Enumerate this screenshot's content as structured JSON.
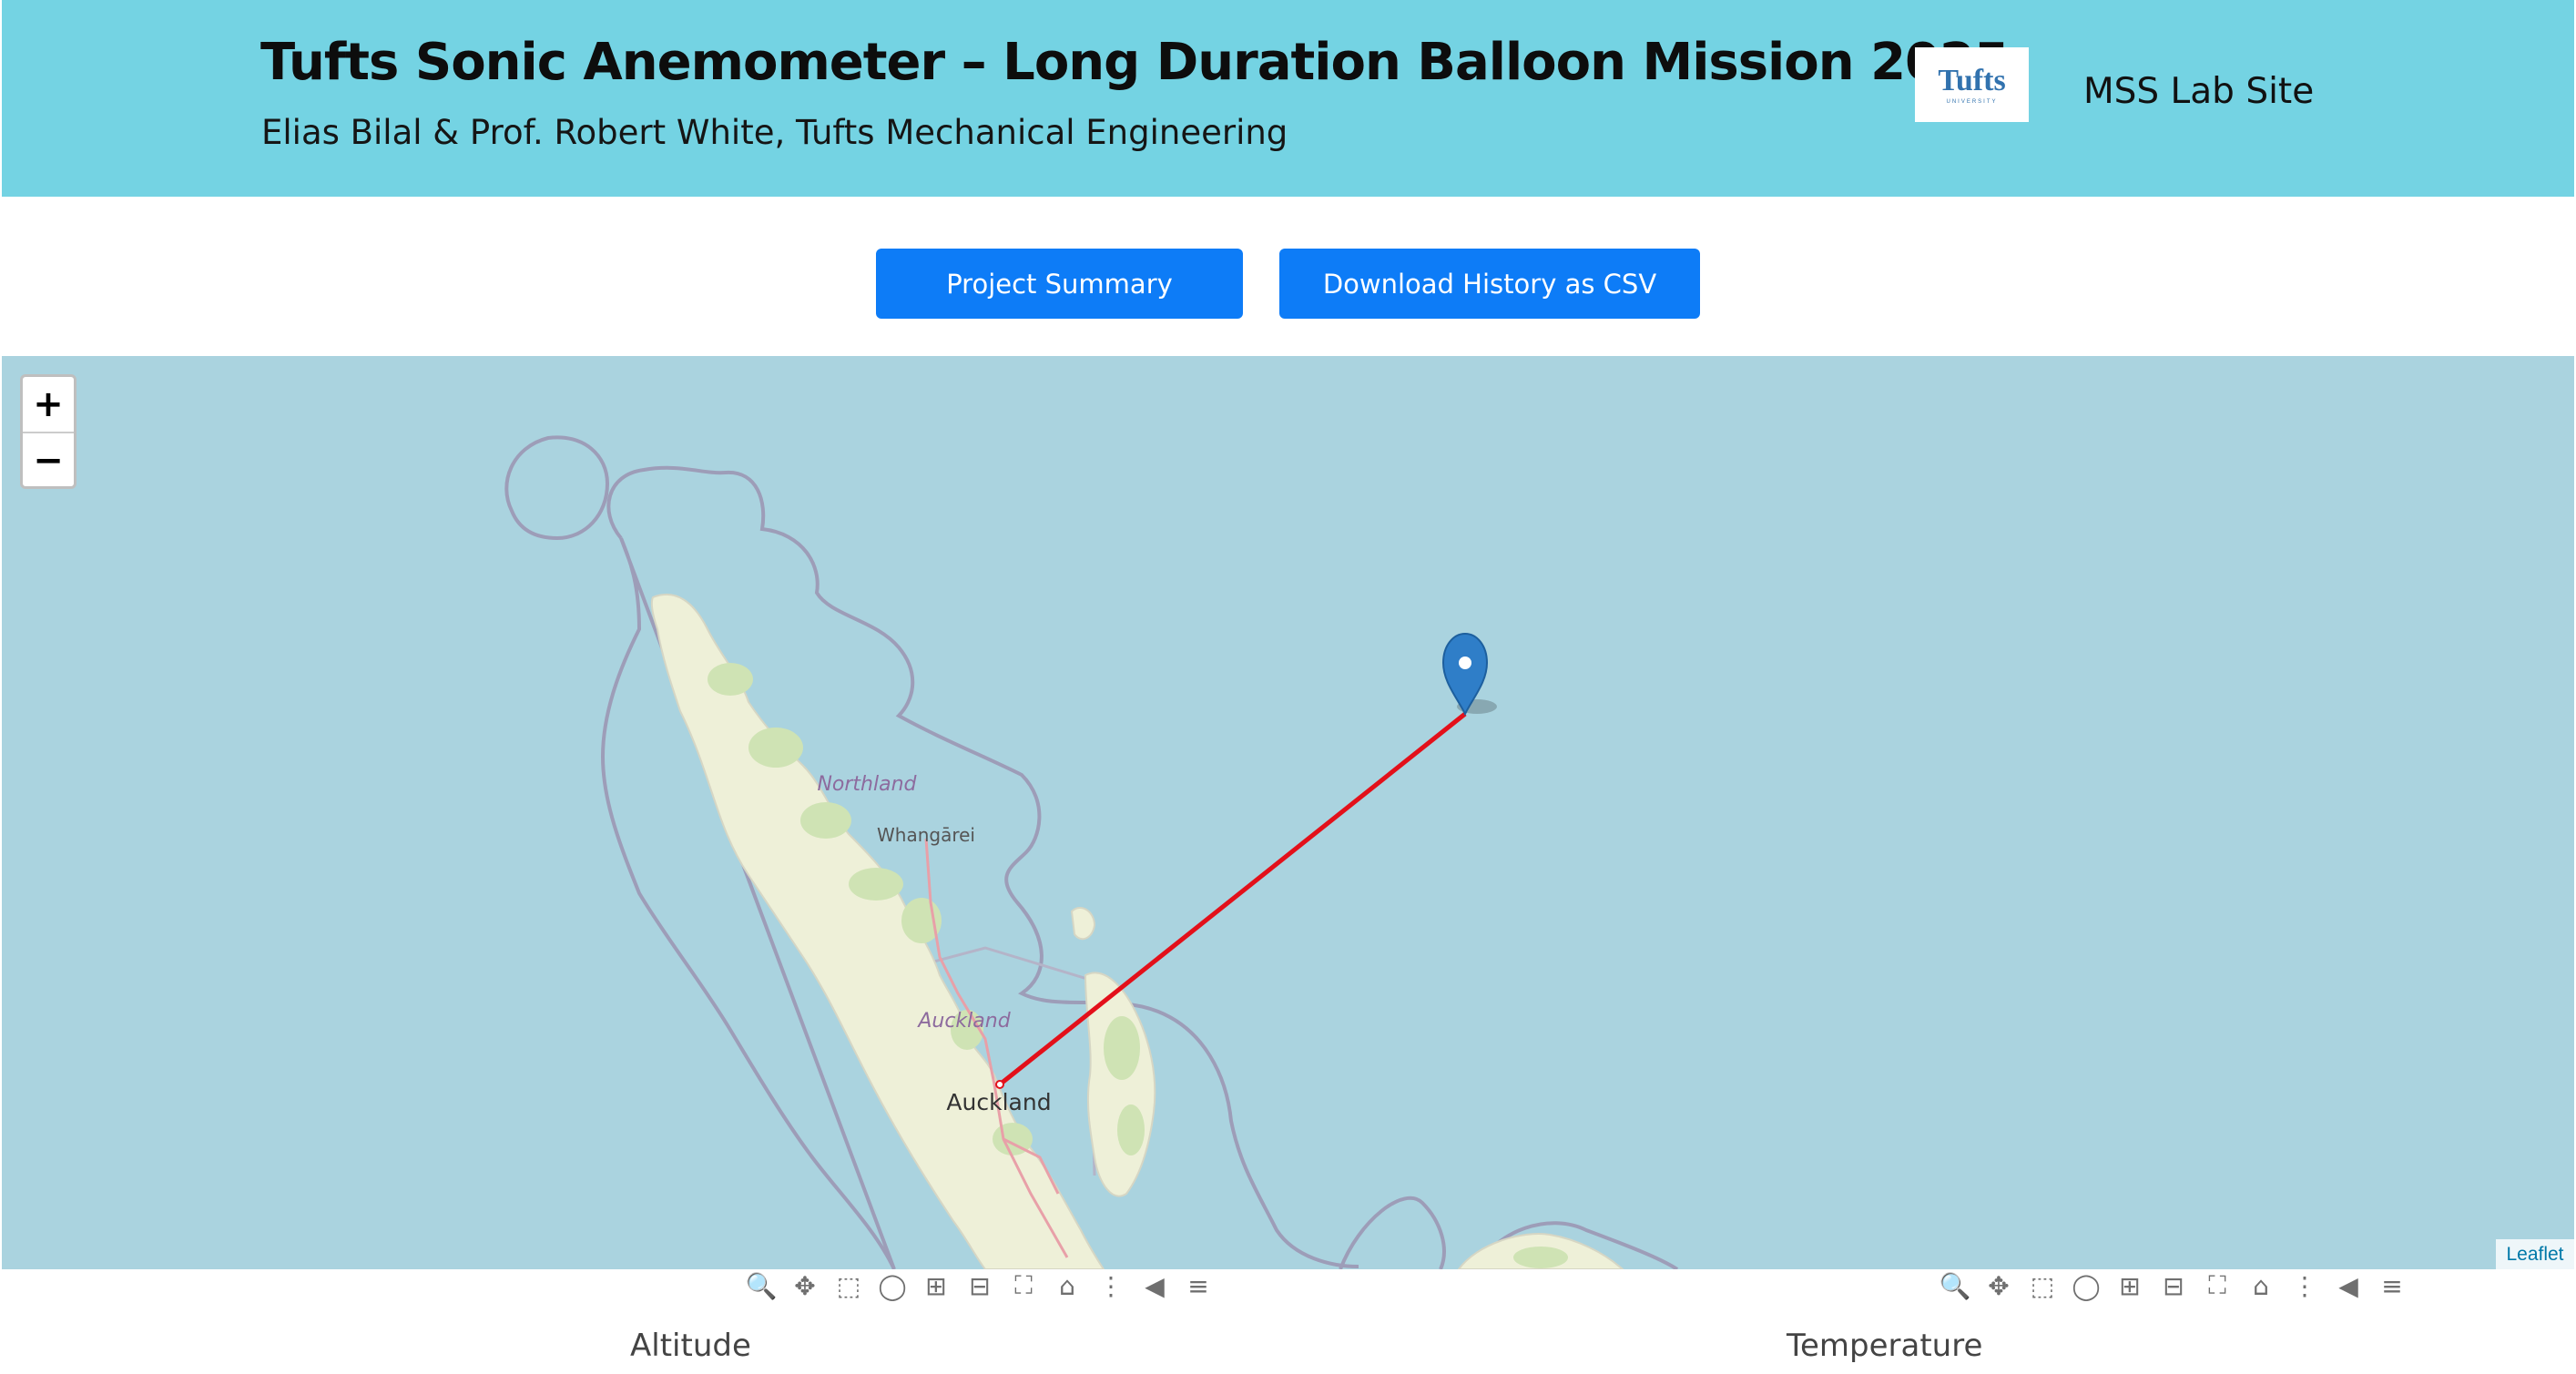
{
  "header": {
    "title": "Tufts Sonic Anemometer – Long Duration Balloon Mission 2025",
    "subtitle": "Elias Bilal & Prof. Robert White, Tufts Mechanical Engineering",
    "logo_text": "Tufts",
    "logo_subtext": "UNIVERSITY",
    "lab_link": "MSS Lab Site",
    "background_color": "#74d3e3"
  },
  "buttons": {
    "summary": "Project Summary",
    "download": "Download History as CSV",
    "color": "#0d7cf7"
  },
  "map": {
    "zoom_in": "+",
    "zoom_out": "−",
    "attribution": "Leaflet",
    "labels": {
      "northland": "Northland",
      "whangarei": "Whangārei",
      "auckland_region": "Auckland",
      "auckland_city": "Auckland"
    },
    "marker_icon": "map-marker-icon",
    "track_color": "#e3101a",
    "water_color": "#aad3df",
    "land_color": "#eef0d8",
    "border_color": "#9d9db8"
  },
  "modebar_icons": [
    "zoom-icon",
    "pan-icon",
    "box-select-icon",
    "lasso-select-icon",
    "zoom-in-icon",
    "zoom-out-icon",
    "autoscale-icon",
    "reset-axes-icon",
    "spike-lines-icon",
    "hover-closest-icon",
    "hover-compare-icon"
  ],
  "charts": {
    "altitude_title": "Altitude",
    "temperature_title": "Temperature"
  }
}
